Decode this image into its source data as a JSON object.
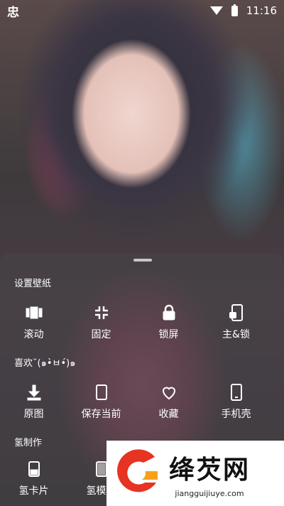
{
  "status": {
    "left_icon": "app-notification-icon",
    "left_glyph": "忠",
    "time": "11:16"
  },
  "sections": [
    {
      "title": "设置壁纸",
      "items": [
        {
          "label": "滚动",
          "icon": "scroll-icon"
        },
        {
          "label": "固定",
          "icon": "fixed-icon"
        },
        {
          "label": "锁屏",
          "icon": "lock-icon"
        },
        {
          "label": "主&锁",
          "icon": "home-lock-icon"
        }
      ]
    },
    {
      "title": "喜欢˘(๑•̀ㅂ•́)๑",
      "items": [
        {
          "label": "原图",
          "icon": "download-icon"
        },
        {
          "label": "保存当前",
          "icon": "save-current-icon"
        },
        {
          "label": "收藏",
          "icon": "heart-icon"
        },
        {
          "label": "手机壳",
          "icon": "phone-case-icon"
        }
      ]
    },
    {
      "title": "氢制作",
      "items": [
        {
          "label": "氢卡片",
          "icon": "card-icon"
        },
        {
          "label": "氢模糊",
          "icon": "blur-icon"
        }
      ]
    }
  ],
  "watermark": {
    "title": "绛芡网",
    "url": "jiangguijiuye.com"
  }
}
